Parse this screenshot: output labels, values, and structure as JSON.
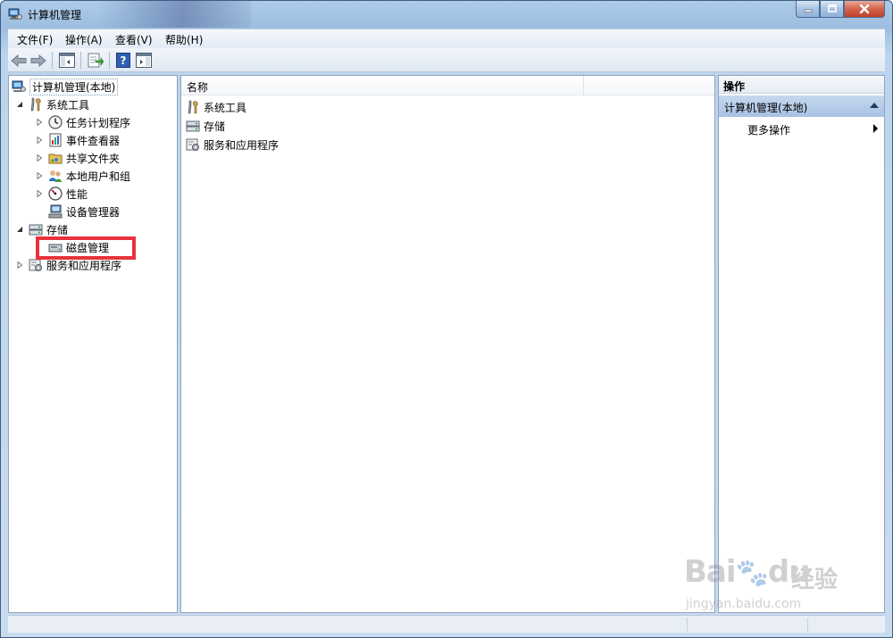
{
  "window": {
    "title": "计算机管理"
  },
  "menubar": {
    "items": [
      {
        "label": "文件(F)"
      },
      {
        "label": "操作(A)"
      },
      {
        "label": "查看(V)"
      },
      {
        "label": "帮助(H)"
      }
    ]
  },
  "tree": {
    "root": "计算机管理(本地)",
    "system_tools": "系统工具",
    "task_scheduler": "任务计划程序",
    "event_viewer": "事件查看器",
    "shared_folders": "共享文件夹",
    "local_users": "本地用户和组",
    "performance": "性能",
    "device_manager": "设备管理器",
    "storage": "存储",
    "disk_management": "磁盘管理",
    "services_apps": "服务和应用程序"
  },
  "list": {
    "column_name": "名称",
    "rows": [
      {
        "label": "系统工具",
        "icon": "tools-icon"
      },
      {
        "label": "存储",
        "icon": "storage-icon"
      },
      {
        "label": "服务和应用程序",
        "icon": "services-icon"
      }
    ]
  },
  "actions": {
    "title": "操作",
    "section": "计算机管理(本地)",
    "more": "更多操作"
  },
  "watermark": {
    "brand": "Bai",
    "brand2": "du",
    "jingyan": "经验",
    "url": "jingyan.baidu.com"
  },
  "colors": {
    "highlight": "#e8323c",
    "selection": "#a8c2e3"
  }
}
